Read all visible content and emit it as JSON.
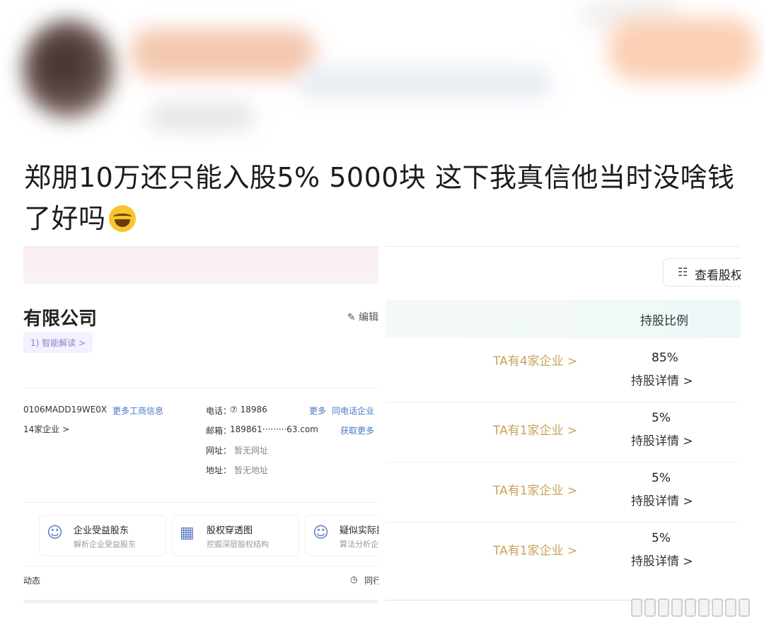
{
  "post": {
    "text": "郑朋10万还只能入股5% 5000块 这下我真信他当时没啥钱了好吗"
  },
  "left_panel": {
    "company_title": "有限公司",
    "edit_label": "✎ 编辑",
    "ai_tag": "1) 智能解读 >",
    "credit_code": "0106MADD19WE0X",
    "more_business": "更多工商信息",
    "related_companies": "14家企业 >",
    "phone_label": "电话：",
    "phone_value": "⑦ 18986",
    "phone_more": "更多",
    "phone_same": "同电话企业",
    "email_label": "邮箱：",
    "email_value": "189861·········63.com",
    "email_more": "获取更多",
    "website_label": "网址：",
    "website_value": "暂无网址",
    "address_label": "地址：",
    "address_value": "暂无地址",
    "cards": [
      {
        "title": "企业受益股东",
        "sub": "解析企业受益股东"
      },
      {
        "title": "股权穿透图",
        "sub": "挖掘深层股权结构"
      },
      {
        "title": "疑似实际控",
        "sub": "算法分析企"
      }
    ],
    "footer_left": "动态",
    "footer_right": "同行"
  },
  "right_panel": {
    "view_button": "查看股权",
    "column_header": "持股比例",
    "rows": [
      {
        "enterprise": "TA有4家企业 >",
        "ratio": "85%",
        "detail": "持股详情 >"
      },
      {
        "enterprise": "TA有1家企业 >",
        "ratio": "5%",
        "detail": "持股详情 >"
      },
      {
        "enterprise": "TA有1家企业 >",
        "ratio": "5%",
        "detail": "持股详情 >"
      },
      {
        "enterprise": "TA有1家企业 >",
        "ratio": "5%",
        "detail": "持股详情 >"
      }
    ]
  },
  "icons": [
    "laughing-tears-emoji",
    "document-icon",
    "user-shield-icon",
    "org-chart-icon",
    "clock-icon",
    "edit-icon"
  ]
}
